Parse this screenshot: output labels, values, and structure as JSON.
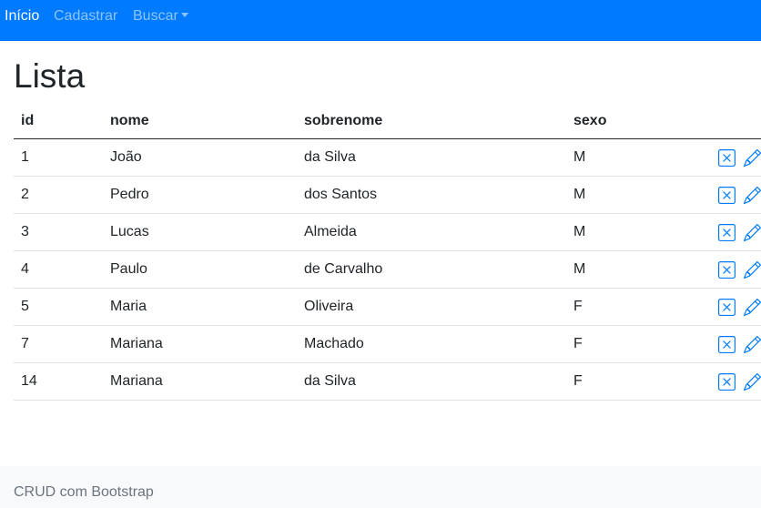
{
  "navbar": {
    "items": [
      {
        "label": "Início",
        "active": true
      },
      {
        "label": "Cadastrar",
        "active": false
      },
      {
        "label": "Buscar",
        "active": false,
        "dropdown": true
      }
    ],
    "background": "#007bff"
  },
  "main": {
    "title": "Lista",
    "table": {
      "columns": [
        "id",
        "nome",
        "sobrenome",
        "sexo"
      ],
      "rows": [
        {
          "id": "1",
          "nome": "João",
          "sobrenome": "da Silva",
          "sexo": "M"
        },
        {
          "id": "2",
          "nome": "Pedro",
          "sobrenome": "dos Santos",
          "sexo": "M"
        },
        {
          "id": "3",
          "nome": "Lucas",
          "sobrenome": "Almeida",
          "sexo": "M"
        },
        {
          "id": "4",
          "nome": "Paulo",
          "sobrenome": "de Carvalho",
          "sexo": "M"
        },
        {
          "id": "5",
          "nome": "Maria",
          "sobrenome": "Oliveira",
          "sexo": "F"
        },
        {
          "id": "7",
          "nome": "Mariana",
          "sobrenome": "Machado",
          "sexo": "F"
        },
        {
          "id": "14",
          "nome": "Mariana",
          "sobrenome": "da Silva",
          "sexo": "F"
        }
      ],
      "row_actions": [
        "x-square-icon",
        "pencil-icon"
      ],
      "action_color": "#007bff"
    }
  },
  "footer": {
    "text": "CRUD com Bootstrap"
  }
}
